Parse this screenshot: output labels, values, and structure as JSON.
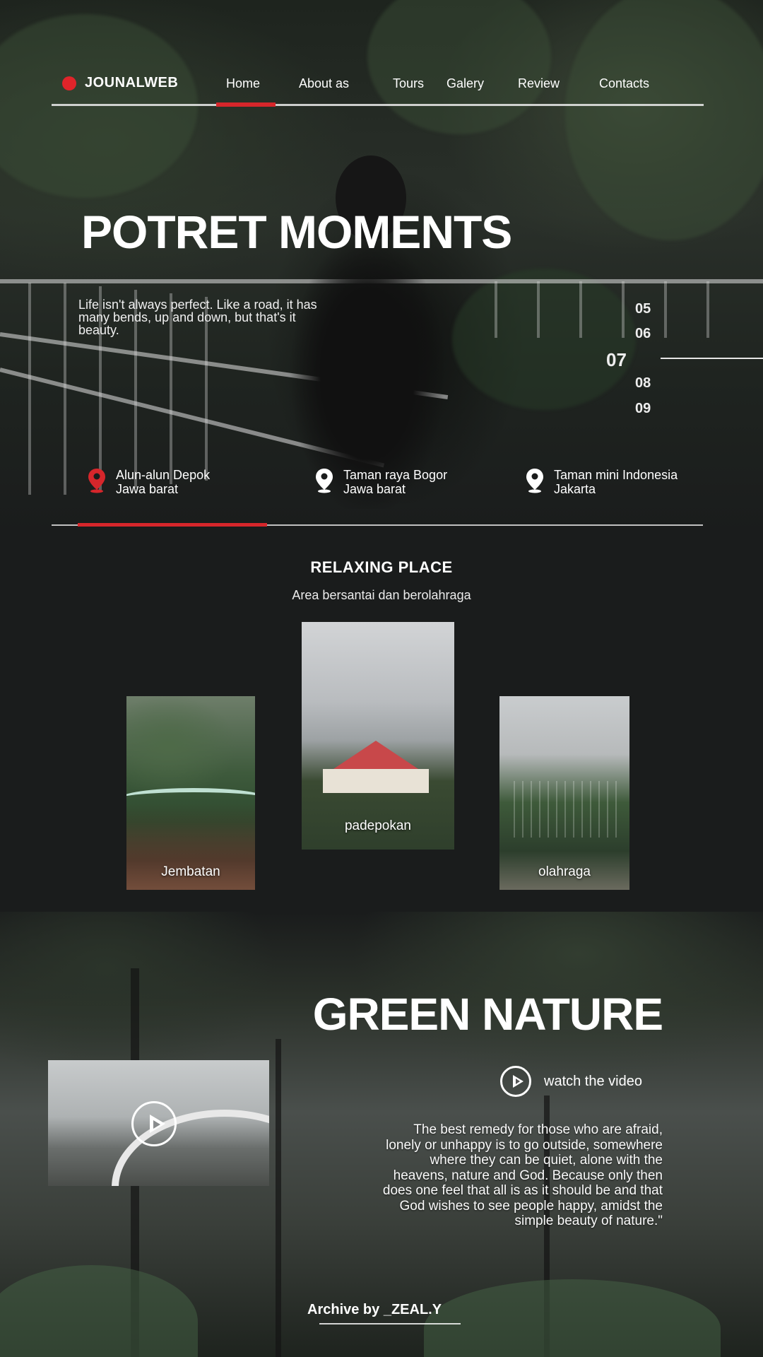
{
  "brand": {
    "name": "JOUNALWEB",
    "accent_color": "#d6262b"
  },
  "nav": {
    "items": [
      {
        "label": "Home",
        "active": true
      },
      {
        "label": "About as",
        "active": false
      },
      {
        "label": "Tours",
        "active": false
      },
      {
        "label": "Galery",
        "active": false
      },
      {
        "label": "Review",
        "active": false
      },
      {
        "label": "Contacts",
        "active": false
      }
    ]
  },
  "hero": {
    "title": "POTRET MOMENTS",
    "quote": "Life isn't always perfect. Like a road, it has many bends, up and down, but that's it beauty.",
    "slides": [
      "05",
      "06",
      "07",
      "08",
      "09"
    ],
    "active_slide": "07",
    "locations": [
      {
        "line1": "Alun-alun Depok",
        "line2": "Jawa barat",
        "icon": "map-pin-icon",
        "highlight": true
      },
      {
        "line1": "Taman raya Bogor",
        "line2": "Jawa barat",
        "icon": "map-pin-icon",
        "highlight": false
      },
      {
        "line1": "Taman mini Indonesia",
        "line2": "Jakarta",
        "icon": "map-pin-icon",
        "highlight": false
      }
    ]
  },
  "relax": {
    "title": "RELAXING PLACE",
    "subtitle": "Area bersantai dan berolahraga",
    "cards": [
      {
        "caption": "Jembatan"
      },
      {
        "caption": "padepokan"
      },
      {
        "caption": "olahraga"
      }
    ]
  },
  "nature": {
    "title": "GREEN NATURE",
    "watch_label": "watch the video",
    "quote_lines": [
      "The best remedy for those who are afraid,",
      "lonely or unhappy is to go outside, somewhere",
      "where they can be quiet, alone with the",
      "heavens, nature and God. Because only then",
      "does one feel that all is as it should be and that",
      "God wishes to see people happy, amidst the",
      "simple beauty of nature.\""
    ],
    "archive": "Archive by _ZEAL.Y"
  }
}
